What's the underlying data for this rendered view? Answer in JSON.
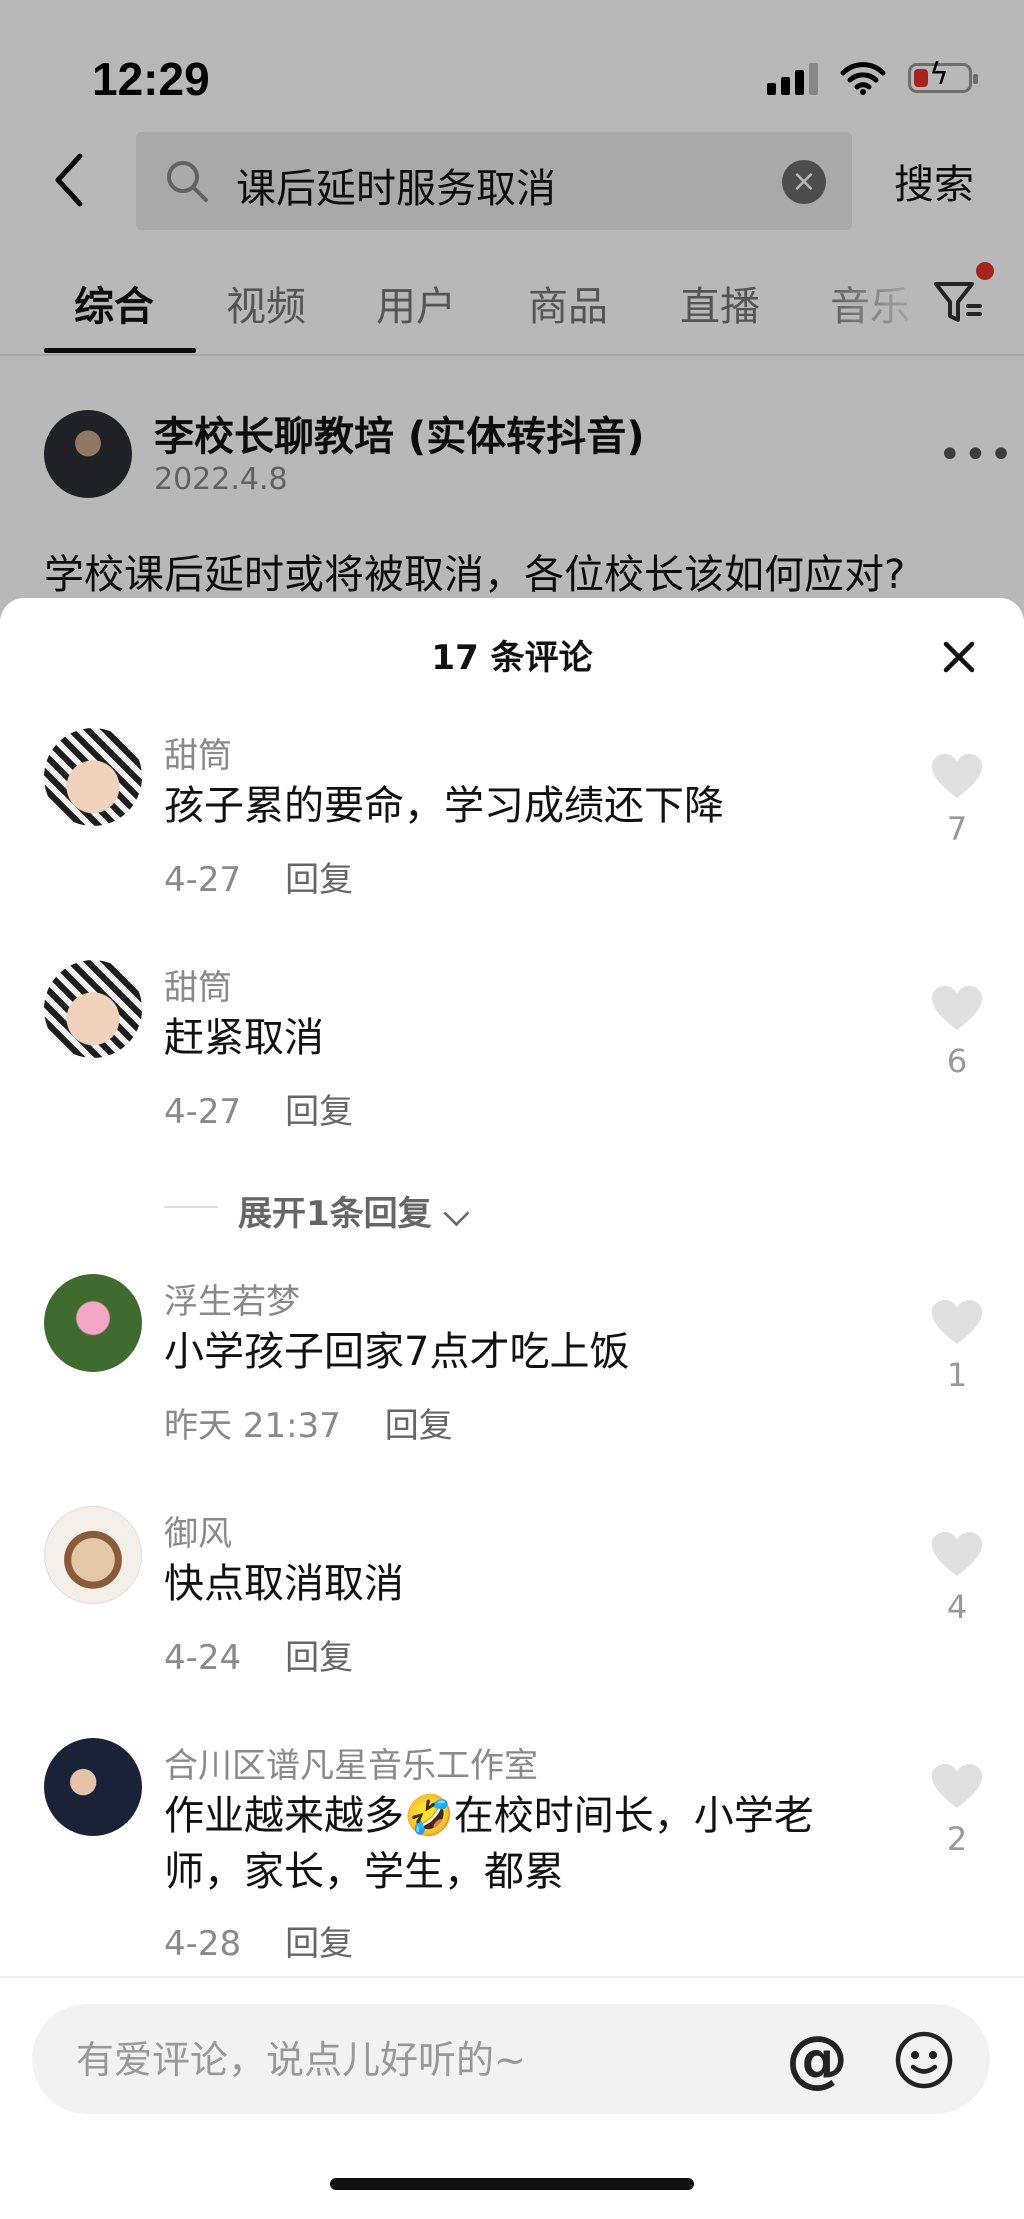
{
  "status_bar": {
    "time": "12:29"
  },
  "search": {
    "query": "课后延时服务取消",
    "button_label": "搜索"
  },
  "tabs": [
    {
      "label": "综合",
      "active": true
    },
    {
      "label": "视频"
    },
    {
      "label": "用户"
    },
    {
      "label": "商品"
    },
    {
      "label": "直播"
    },
    {
      "label": "音乐"
    }
  ],
  "post": {
    "author": "李校长聊教培 (实体转抖音)",
    "date": "2022.4.8",
    "text": "学校课后延时或将被取消，各位校长该如何应对?"
  },
  "comments_sheet": {
    "title": "17 条评论",
    "reply_label": "回复",
    "expand_label": "展开1条回复",
    "comments": [
      {
        "user": "甜筒",
        "text": "孩子累的要命，学习成绩还下降",
        "time": "4-27",
        "likes": "7"
      },
      {
        "user": "甜筒",
        "text": "赶紧取消",
        "time": "4-27",
        "likes": "6"
      },
      {
        "user": "浮生若梦",
        "text": "小学孩子回家7点才吃上饭",
        "time": "昨天 21:37",
        "likes": "1"
      },
      {
        "user": "御风",
        "text": "快点取消取消",
        "time": "4-24",
        "likes": "4"
      },
      {
        "user": "合川区谱凡星音乐工作室",
        "text": "作业越来越多🤣在校时间长，小学老师，家长，学生，都累",
        "time": "4-28",
        "likes": "2"
      }
    ]
  },
  "comment_input": {
    "placeholder": "有爱评论，说点儿好听的~"
  },
  "colors": {
    "notification_dot": "#e5342a",
    "battery_low": "#e5342a"
  }
}
